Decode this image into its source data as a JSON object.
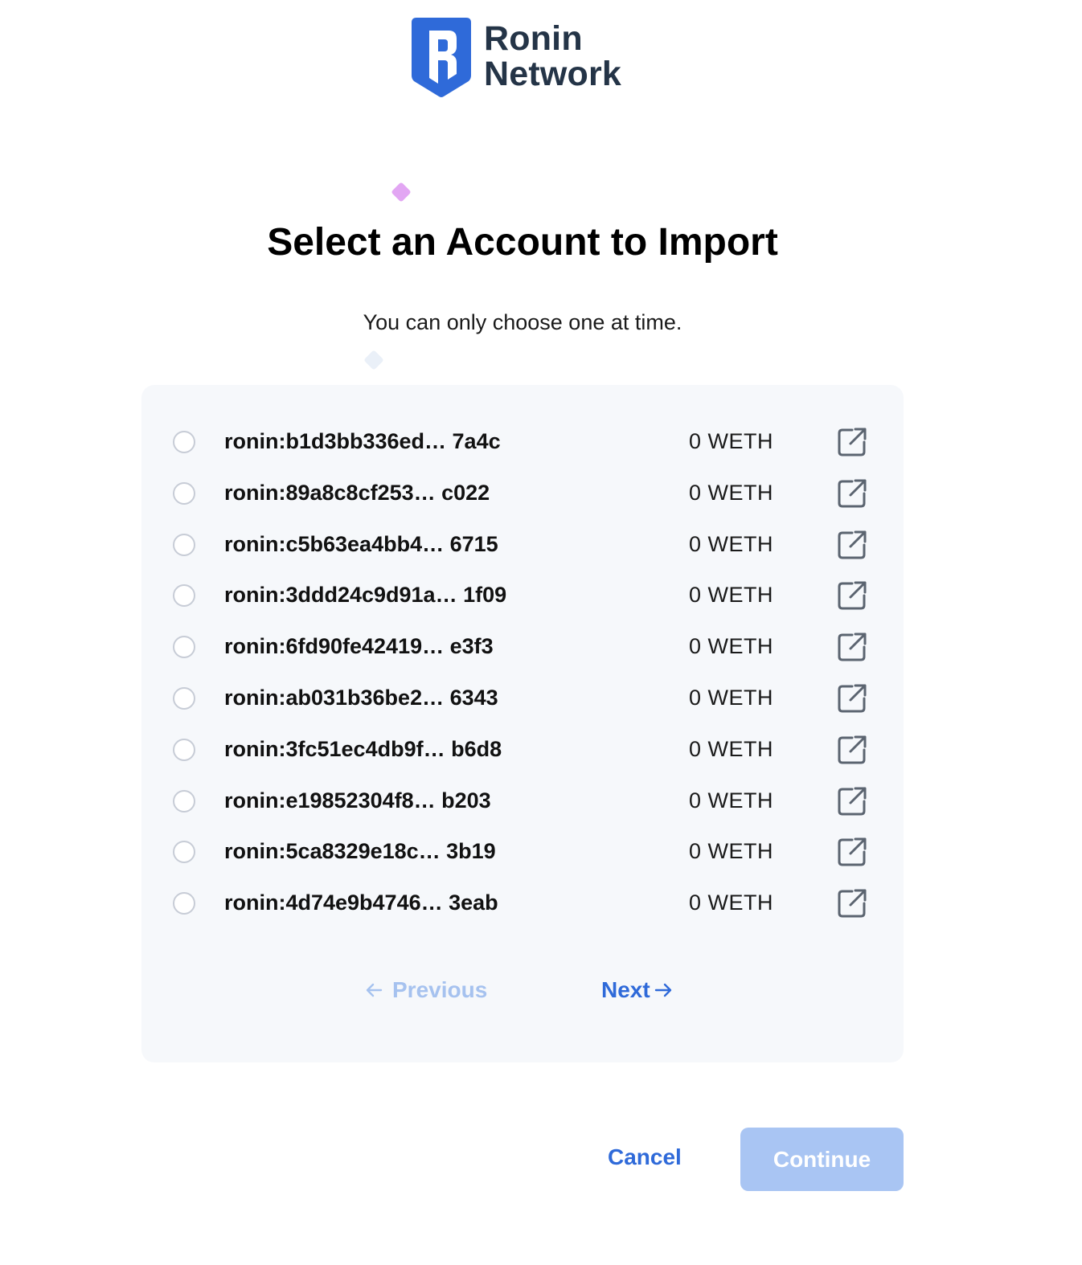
{
  "brand": {
    "line1": "Ronin",
    "line2": "Network",
    "accent_color": "#2f6ad9"
  },
  "header": {
    "title": "Select an Account to Import",
    "subtitle": "You can only choose one at time."
  },
  "accounts": [
    {
      "address": "ronin:b1d3bb336ed… 7a4c",
      "balance": "0 WETH",
      "selected": false
    },
    {
      "address": "ronin:89a8c8cf253… c022",
      "balance": "0 WETH",
      "selected": false
    },
    {
      "address": "ronin:c5b63ea4bb4… 6715",
      "balance": "0 WETH",
      "selected": false
    },
    {
      "address": "ronin:3ddd24c9d91a… 1f09",
      "balance": "0 WETH",
      "selected": false
    },
    {
      "address": "ronin:6fd90fe42419… e3f3",
      "balance": "0 WETH",
      "selected": false
    },
    {
      "address": "ronin:ab031b36be2… 6343",
      "balance": "0 WETH",
      "selected": false
    },
    {
      "address": "ronin:3fc51ec4db9f… b6d8",
      "balance": "0 WETH",
      "selected": false
    },
    {
      "address": "ronin:e19852304f8… b203",
      "balance": "0 WETH",
      "selected": false
    },
    {
      "address": "ronin:5ca8329e18c… 3b19",
      "balance": "0 WETH",
      "selected": false
    },
    {
      "address": "ronin:4d74e9b4746… 3eab",
      "balance": "0 WETH",
      "selected": false
    }
  ],
  "pagination": {
    "previous_label": "Previous",
    "next_label": "Next",
    "previous_enabled": false
  },
  "actions": {
    "cancel_label": "Cancel",
    "continue_label": "Continue",
    "continue_enabled": false
  },
  "icons": {
    "logo": "ronin-shield-icon",
    "external_link": "external-link-icon",
    "prev_arrow": "arrow-left-icon",
    "next_arrow": "arrow-right-icon"
  }
}
